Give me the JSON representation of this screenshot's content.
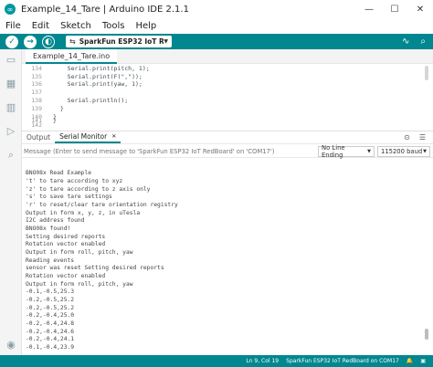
{
  "window": {
    "title": "Example_14_Tare | Arduino IDE 2.1.1",
    "minimize_glyph": "—",
    "maximize_glyph": "☐",
    "close_glyph": "✕",
    "app_icon_glyph": "∞"
  },
  "menu": [
    "File",
    "Edit",
    "Sketch",
    "Tools",
    "Help"
  ],
  "toolbar": {
    "verify_glyph": "✓",
    "upload_glyph": "→",
    "debug_glyph": "◐",
    "board_usb_glyph": "⇆",
    "board_label": "SparkFun ESP32 IoT Re...",
    "board_caret": "▼",
    "plotter_glyph": "∿",
    "monitor_glyph": "⌕"
  },
  "editor": {
    "tab_label": "Example_14_Tare.ino",
    "lines": [
      {
        "num": "134",
        "text": "    Serial.print(pitch, 1);"
      },
      {
        "num": "135",
        "text": "    Serial.print(F(\",\"));"
      },
      {
        "num": "136",
        "text": "    Serial.print(yaw, 1);"
      },
      {
        "num": "137",
        "text": ""
      },
      {
        "num": "138",
        "text": "    Serial.println();"
      },
      {
        "num": "139",
        "text": "  }"
      },
      {
        "num": "140",
        "text": "}"
      },
      {
        "num": "141",
        "text": "}"
      },
      {
        "num": "142",
        "text": ""
      }
    ]
  },
  "panel": {
    "tabs": [
      "Output",
      "Serial Monitor"
    ],
    "active_tab": "Serial Monitor",
    "close_glyph": "✕",
    "icons": {
      "toggle_timestamp": "⊙",
      "clear": "☰"
    },
    "message_placeholder": "Message (Enter to send message to 'SparkFun ESP32 IoT RedBoard' on 'COM17')",
    "line_ending": "No Line Ending",
    "baud": "115200 baud",
    "caret": "▼"
  },
  "serial_output": [
    "BNO08x Read Example",
    "'t' to tare according to xyz",
    "'z' to tare according to z axis only",
    "'s' to save tare settings",
    "'r' to reset/clear tare orientation registry",
    "Output in form x, y, z, in uTesla",
    "I2C address found",
    "BNO08x found!",
    "Setting desired reports",
    "Rotation vector enabled",
    "Output in form roll, pitch, yaw",
    "Reading events",
    "sensor was reset Setting desired reports",
    "Rotation vector enabled",
    "Output in form roll, pitch, yaw",
    "-0.1,-0.5,25.3",
    "-0.2,-0.5,25.2",
    "-0.2,-0.5,25.2",
    "-0.2,-0.4,25.0",
    "-0.2,-0.4,24.8",
    "-0.2,-0.4,24.6",
    "-0.2,-0.4,24.1",
    "-0.1,-0.4,23.9"
  ],
  "sidebar_icons": [
    "folder-icon",
    "board-icon",
    "library-icon",
    "debug-icon",
    "search-icon",
    "account-icon"
  ],
  "sidebar_glyphs": {
    "folder": "▭",
    "board": "▦",
    "library": "▥",
    "debug": "▷",
    "search": "⌕",
    "account": "◉"
  },
  "status_bar": {
    "position": "Ln 9, Col 19",
    "board": "SparkFun ESP32 IoT RedBoard on COM17",
    "notification_glyph": "🔔",
    "terminal_glyph": "▣"
  },
  "colors": {
    "accent": "#00878f",
    "code_text": "#434f54",
    "keyword": "#d35400"
  }
}
